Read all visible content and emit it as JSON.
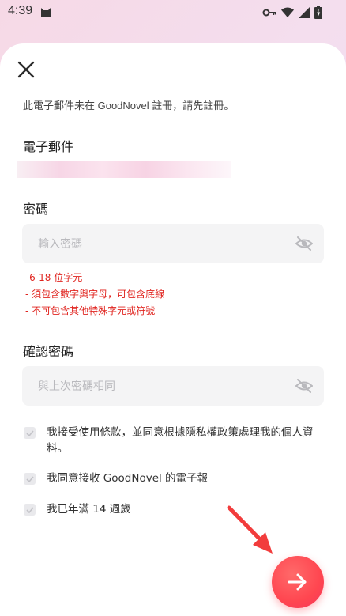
{
  "status_bar": {
    "time": "4:39",
    "icons": [
      "cat-icon",
      "key-icon",
      "signal-icon",
      "wifi-icon",
      "battery-icon"
    ]
  },
  "form": {
    "notice": "此電子郵件未在 GoodNovel 註冊，請先註冊。",
    "email_label": "電子郵件",
    "email_value": "",
    "password_label": "密碼",
    "password_placeholder": "輸入密碼",
    "password_rules": [
      "- 6-18 位字元",
      "- 須包含數字與字母，可包含底線",
      "- 不可包含其他特殊字元或符號"
    ],
    "confirm_label": "確認密碼",
    "confirm_placeholder": "與上次密碼相同"
  },
  "consents": [
    {
      "text": "我接受使用條款，並同意根據隱私權政策處理我的個人資料。",
      "checked": true
    },
    {
      "text": "我同意接收 GoodNovel 的電子報",
      "checked": true
    },
    {
      "text": "我已年滿 14 週歲",
      "checked": true
    }
  ],
  "colors": {
    "accent": "#ff4650",
    "error_text": "#e0241f",
    "field_bg": "#f4f4f5",
    "annotation_arrow": "#f23c3c"
  }
}
